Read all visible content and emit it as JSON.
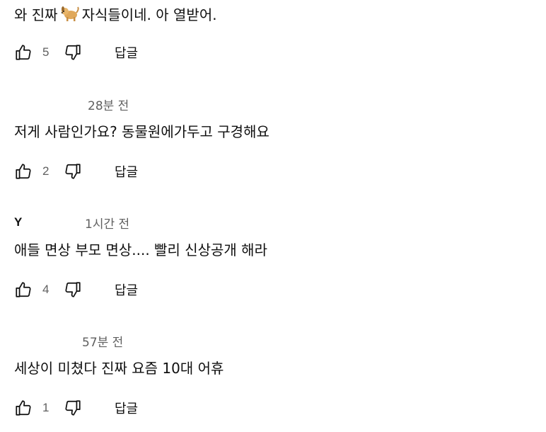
{
  "comments": [
    {
      "author": "",
      "timestamp": "",
      "text_before_emoji": "와 진짜",
      "emoji_icon": "dog-icon",
      "text_after_emoji": "자식들이네. 아 열받어.",
      "likes": "5",
      "reply_label": "답글"
    },
    {
      "author": "",
      "timestamp": "28분 전",
      "text": "저게 사람인가요? 동물원에가두고 구경해요",
      "likes": "2",
      "reply_label": "답글"
    },
    {
      "author": "Y",
      "timestamp": "1시간 전",
      "text": "애들 면상 부모 면상.... 빨리 신상공개 해라",
      "likes": "4",
      "reply_label": "답글"
    },
    {
      "author": "",
      "timestamp": "57분 전",
      "text": "세상이 미쳤다 진짜 요즘 10대 어휴",
      "likes": "1",
      "reply_label": "답글"
    }
  ],
  "icons": {
    "like": "thumbs-up-icon",
    "dislike": "thumbs-down-icon"
  },
  "colors": {
    "text": "#0f0f0f",
    "secondary": "#606060",
    "background": "#ffffff"
  }
}
